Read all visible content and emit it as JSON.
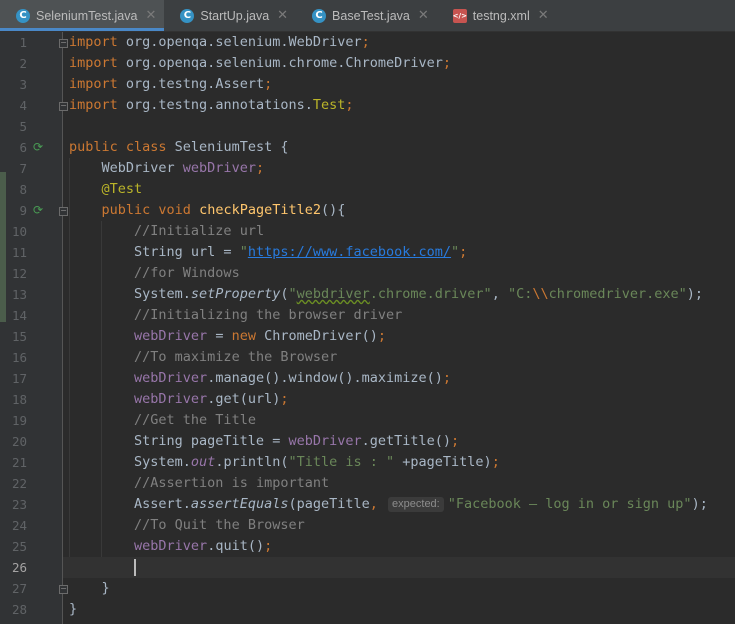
{
  "tabs": [
    {
      "label": "SeleniumTest.java",
      "icon": "java-class-icon",
      "active": true
    },
    {
      "label": "StartUp.java",
      "icon": "java-class-icon",
      "active": false
    },
    {
      "label": "BaseTest.java",
      "icon": "java-class-icon",
      "active": false
    },
    {
      "label": "testng.xml",
      "icon": "xml-file-icon",
      "active": false
    }
  ],
  "editor": {
    "current_line": 26,
    "line_numbers": [
      "1",
      "2",
      "3",
      "4",
      "5",
      "6",
      "7",
      "8",
      "9",
      "10",
      "11",
      "12",
      "13",
      "14",
      "15",
      "16",
      "17",
      "18",
      "19",
      "20",
      "21",
      "22",
      "23",
      "24",
      "25",
      "26",
      "27",
      "28"
    ],
    "run_icon_lines": [
      6,
      9
    ],
    "inlay_hint": "expected:",
    "colors": {
      "background": "#2b2b2b",
      "keyword": "#cc7832",
      "string": "#6a8759",
      "comment": "#808080",
      "field": "#9876aa",
      "annotation": "#bbb529",
      "method": "#ffc66d"
    },
    "lines": [
      [
        {
          "t": "import",
          "c": "kw"
        },
        {
          "t": " org.openqa.selenium.WebDriver"
        },
        {
          "t": ";",
          "c": "kw"
        }
      ],
      [
        {
          "t": "import",
          "c": "kw"
        },
        {
          "t": " org.openqa.selenium.chrome.ChromeDriver"
        },
        {
          "t": ";",
          "c": "kw"
        }
      ],
      [
        {
          "t": "import",
          "c": "kw"
        },
        {
          "t": " org.testng.Assert"
        },
        {
          "t": ";",
          "c": "kw"
        }
      ],
      [
        {
          "t": "import",
          "c": "kw"
        },
        {
          "t": " org.testng.annotations."
        },
        {
          "t": "Test",
          "c": "ann"
        },
        {
          "t": ";",
          "c": "kw"
        }
      ],
      [],
      [
        {
          "t": "public class",
          "c": "kw"
        },
        {
          "t": " SeleniumTest {"
        }
      ],
      [
        {
          "t": "    WebDriver "
        },
        {
          "t": "webDriver",
          "c": "fld"
        },
        {
          "t": ";",
          "c": "kw"
        }
      ],
      [
        {
          "t": "    "
        },
        {
          "t": "@Test",
          "c": "ann"
        }
      ],
      [
        {
          "t": "    "
        },
        {
          "t": "public void",
          "c": "kw"
        },
        {
          "t": " "
        },
        {
          "t": "checkPageTitle2",
          "c": "mth"
        },
        {
          "t": "(){"
        }
      ],
      [
        {
          "t": "        "
        },
        {
          "t": "//Initialize url",
          "c": "cmt"
        }
      ],
      [
        {
          "t": "        String url = "
        },
        {
          "t": "\"",
          "c": "str"
        },
        {
          "t": "https://www.facebook.com/",
          "c": "link"
        },
        {
          "t": "\"",
          "c": "str"
        },
        {
          "t": ";",
          "c": "kw"
        }
      ],
      [
        {
          "t": "        "
        },
        {
          "t": "//for Windows",
          "c": "cmt"
        }
      ],
      [
        {
          "t": "        System."
        },
        {
          "t": "setProperty",
          "c": "it"
        },
        {
          "t": "("
        },
        {
          "t": "\"",
          "c": "str"
        },
        {
          "t": "webdriver",
          "c": "str wavy"
        },
        {
          "t": ".chrome.driver\"",
          "c": "str"
        },
        {
          "t": ", "
        },
        {
          "t": "\"C:",
          "c": "str"
        },
        {
          "t": "\\\\",
          "c": "esc"
        },
        {
          "t": "chromedriver.exe\"",
          "c": "str"
        },
        {
          "t": ");"
        }
      ],
      [
        {
          "t": "        "
        },
        {
          "t": "//Initializing the browser driver",
          "c": "cmt"
        }
      ],
      [
        {
          "t": "        "
        },
        {
          "t": "webDriver",
          "c": "fld"
        },
        {
          "t": " = "
        },
        {
          "t": "new",
          "c": "kw"
        },
        {
          "t": " ChromeDriver()"
        },
        {
          "t": ";",
          "c": "kw"
        }
      ],
      [
        {
          "t": "        "
        },
        {
          "t": "//To maximize the Browser",
          "c": "cmt"
        }
      ],
      [
        {
          "t": "        "
        },
        {
          "t": "webDriver",
          "c": "fld"
        },
        {
          "t": ".manage().window().maximize()"
        },
        {
          "t": ";",
          "c": "kw"
        }
      ],
      [
        {
          "t": "        "
        },
        {
          "t": "webDriver",
          "c": "fld"
        },
        {
          "t": ".get(url)"
        },
        {
          "t": ";",
          "c": "kw"
        }
      ],
      [
        {
          "t": "        "
        },
        {
          "t": "//Get the Title",
          "c": "cmt"
        }
      ],
      [
        {
          "t": "        String pageTitle = "
        },
        {
          "t": "webDriver",
          "c": "fld"
        },
        {
          "t": ".getTitle()"
        },
        {
          "t": ";",
          "c": "kw"
        }
      ],
      [
        {
          "t": "        System."
        },
        {
          "t": "out",
          "c": "fld it"
        },
        {
          "t": ".println("
        },
        {
          "t": "\"Title is : \"",
          "c": "str"
        },
        {
          "t": " +pageTitle)"
        },
        {
          "t": ";",
          "c": "kw"
        }
      ],
      [
        {
          "t": "        "
        },
        {
          "t": "//Assertion is important",
          "c": "cmt"
        }
      ],
      [
        {
          "t": "        Assert."
        },
        {
          "t": "assertEquals",
          "c": "it"
        },
        {
          "t": "(pageTitle"
        },
        {
          "t": ",",
          "c": "kw"
        },
        {
          "t": " "
        },
        {
          "t": "expected:",
          "c": "hint"
        },
        {
          "t": "\"Facebook – log in or sign up\"",
          "c": "str"
        },
        {
          "t": ");"
        }
      ],
      [
        {
          "t": "        "
        },
        {
          "t": "//To Quit the Browser",
          "c": "cmt"
        }
      ],
      [
        {
          "t": "        "
        },
        {
          "t": "webDriver",
          "c": "fld"
        },
        {
          "t": ".quit()"
        },
        {
          "t": ";",
          "c": "kw"
        }
      ],
      [],
      [
        {
          "t": "    }"
        }
      ],
      [
        {
          "t": "}"
        }
      ]
    ]
  }
}
